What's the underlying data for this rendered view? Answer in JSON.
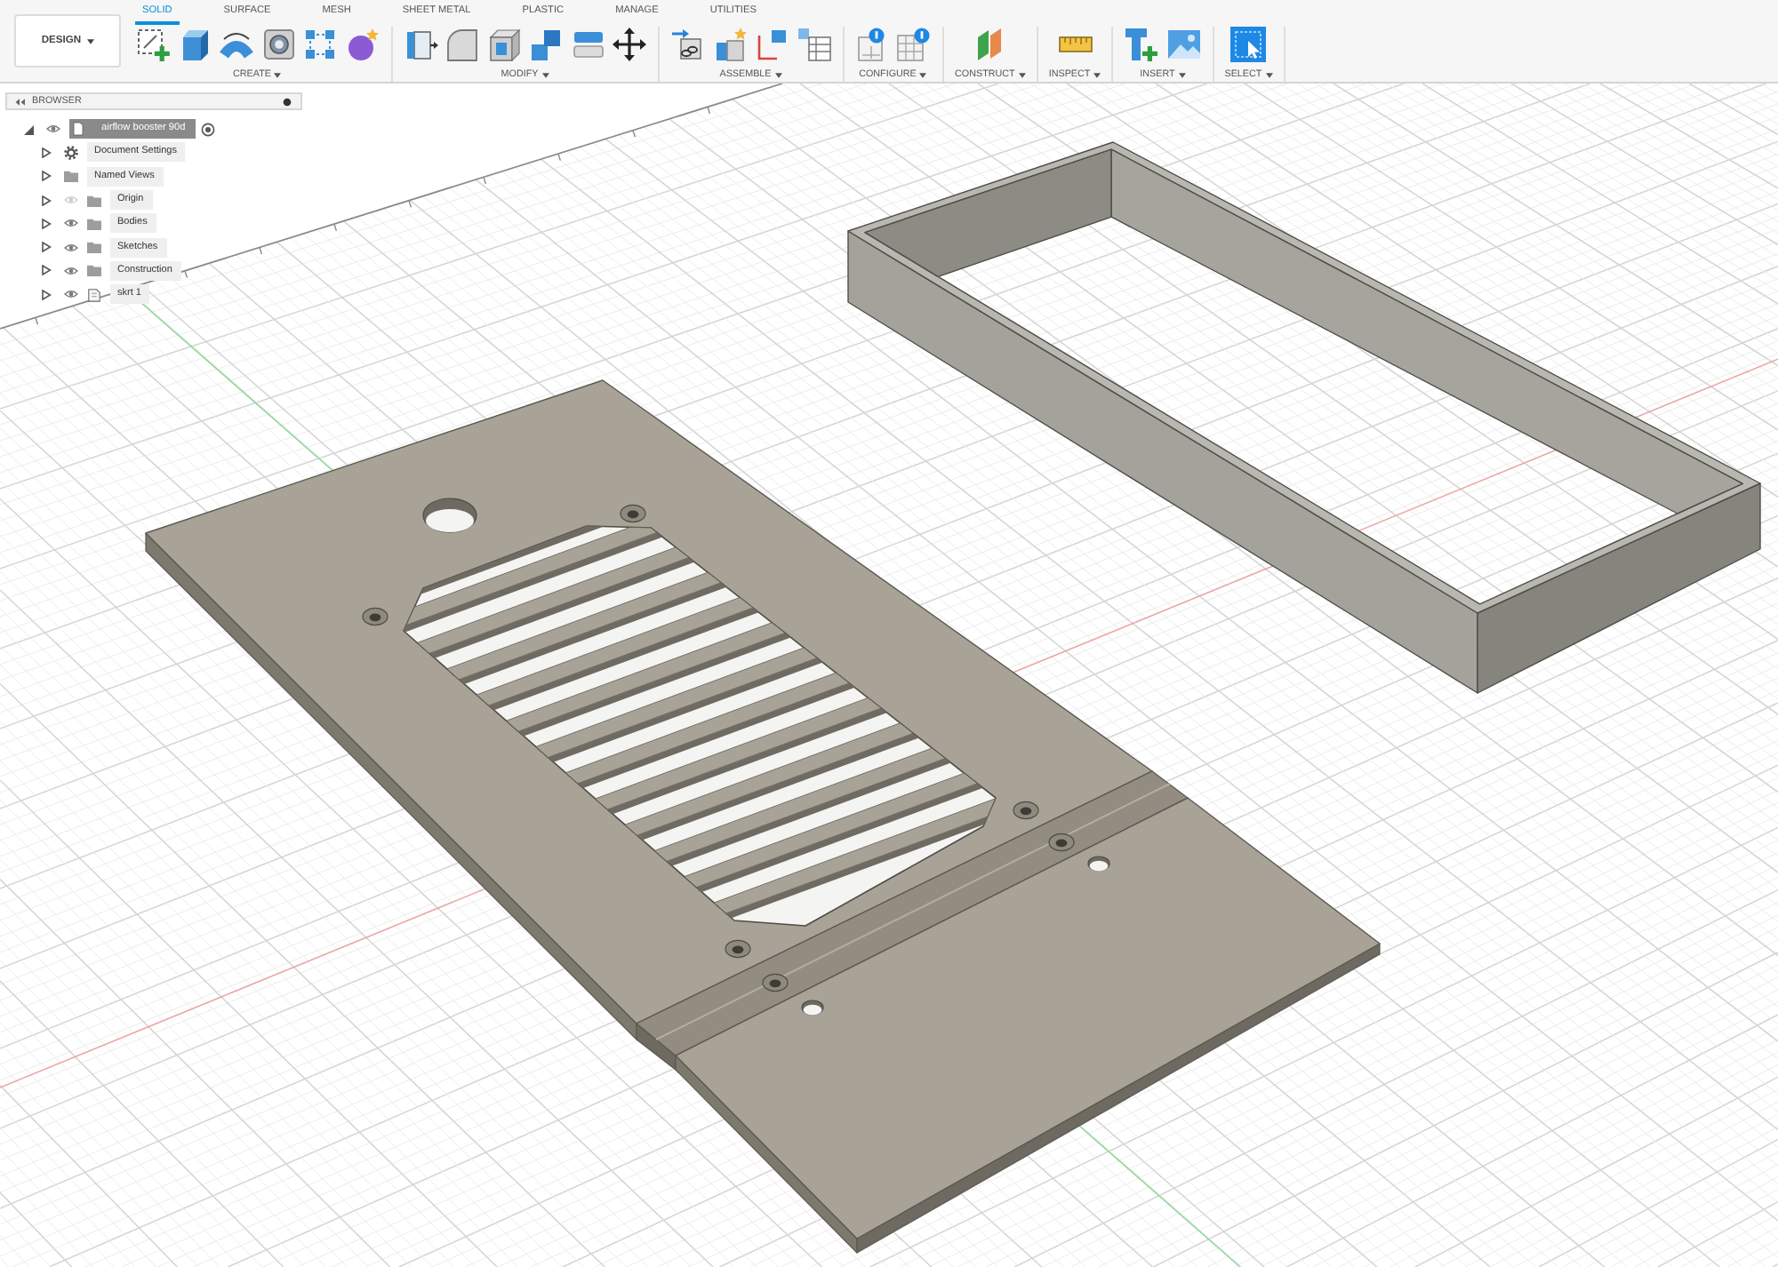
{
  "toolbar": {
    "workspace": "DESIGN",
    "tabs": [
      {
        "label": "SOLID",
        "selected": true
      },
      {
        "label": "SURFACE",
        "selected": false
      },
      {
        "label": "MESH",
        "selected": false
      },
      {
        "label": "SHEET METAL",
        "selected": false
      },
      {
        "label": "PLASTIC",
        "selected": false
      },
      {
        "label": "MANAGE",
        "selected": false
      },
      {
        "label": "UTILITIES",
        "selected": false
      }
    ],
    "groups": [
      "CREATE",
      "MODIFY",
      "ASSEMBLE",
      "CONFIGURE",
      "CONSTRUCT",
      "INSPECT",
      "INSERT",
      "SELECT"
    ]
  },
  "browser": {
    "title": "BROWSER",
    "root": {
      "label": "airflow booster 90d",
      "selected": true,
      "expanded": true,
      "visible": true,
      "children": [
        {
          "kind": "settings",
          "label": "Document Settings",
          "selected": false,
          "expanded": false
        },
        {
          "kind": "folder",
          "label": "Named Views",
          "selected": false,
          "expanded": false
        },
        {
          "kind": "folder",
          "label": "Origin",
          "selected": false,
          "expanded": false,
          "visible": false
        },
        {
          "kind": "folder",
          "label": "Bodies",
          "selected": false,
          "expanded": false,
          "visible": true
        },
        {
          "kind": "folder",
          "label": "Sketches",
          "selected": false,
          "expanded": false,
          "visible": true
        },
        {
          "kind": "folder",
          "label": "Construction",
          "selected": false,
          "expanded": false,
          "visible": true
        },
        {
          "kind": "component",
          "label": "skrt 1",
          "selected": false,
          "expanded": false,
          "visible": true
        }
      ]
    }
  }
}
